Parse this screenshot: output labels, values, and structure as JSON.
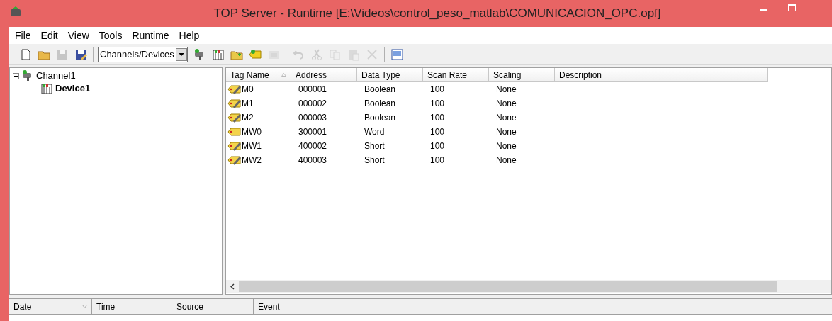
{
  "window": {
    "title": "TOP Server - Runtime [E:\\Videos\\control_peso_matlab\\COMUNICACION_OPC.opf]"
  },
  "menu": [
    "File",
    "Edit",
    "View",
    "Tools",
    "Runtime",
    "Help"
  ],
  "toolbar": [
    {
      "kind": "new",
      "disabled": false
    },
    {
      "kind": "open",
      "disabled": false
    },
    {
      "kind": "save",
      "disabled": true
    },
    {
      "kind": "saveas",
      "disabled": false
    },
    {
      "kind": "sep"
    },
    {
      "kind": "combo",
      "value": "Channels/Devices"
    },
    {
      "kind": "channel",
      "disabled": false
    },
    {
      "kind": "device",
      "disabled": false
    },
    {
      "kind": "folder",
      "disabled": false
    },
    {
      "kind": "tag",
      "disabled": false
    },
    {
      "kind": "props",
      "disabled": true
    },
    {
      "kind": "sep"
    },
    {
      "kind": "undo",
      "disabled": true
    },
    {
      "kind": "cut",
      "disabled": true
    },
    {
      "kind": "copy",
      "disabled": true
    },
    {
      "kind": "paste",
      "disabled": true
    },
    {
      "kind": "delete",
      "disabled": true
    },
    {
      "kind": "sep"
    },
    {
      "kind": "qc",
      "disabled": false
    }
  ],
  "tree": [
    {
      "label": "Channel1",
      "kind": "channel",
      "expanded": true,
      "children": [
        {
          "label": "Device1",
          "kind": "device",
          "selected": true
        }
      ]
    }
  ],
  "table": {
    "columns": [
      {
        "label": "Tag Name",
        "sorted": true
      },
      {
        "label": "Address",
        "sorted": false
      },
      {
        "label": "Data Type",
        "sorted": false
      },
      {
        "label": "Scan Rate",
        "sorted": false
      },
      {
        "label": "Scaling",
        "sorted": false
      },
      {
        "label": "Description",
        "sorted": false
      }
    ],
    "rows": [
      {
        "kind": "writable",
        "cells": [
          "M0",
          "000001",
          "Boolean",
          "100",
          "None"
        ]
      },
      {
        "kind": "writable",
        "cells": [
          "M1",
          "000002",
          "Boolean",
          "100",
          "None"
        ]
      },
      {
        "kind": "writable",
        "cells": [
          "M2",
          "000003",
          "Boolean",
          "100",
          "None"
        ]
      },
      {
        "kind": "readonly",
        "cells": [
          "MW0",
          "300001",
          "Word",
          "100",
          "None"
        ]
      },
      {
        "kind": "writable",
        "cells": [
          "MW1",
          "400002",
          "Short",
          "100",
          "None"
        ]
      },
      {
        "kind": "writable",
        "cells": [
          "MW2",
          "400003",
          "Short",
          "100",
          "None"
        ]
      }
    ]
  },
  "event_log": {
    "columns": [
      {
        "label": "Date",
        "sorted": true
      },
      {
        "label": "Time",
        "sorted": false
      },
      {
        "label": "Source",
        "sorted": false
      },
      {
        "label": "Event",
        "sorted": false
      }
    ]
  }
}
